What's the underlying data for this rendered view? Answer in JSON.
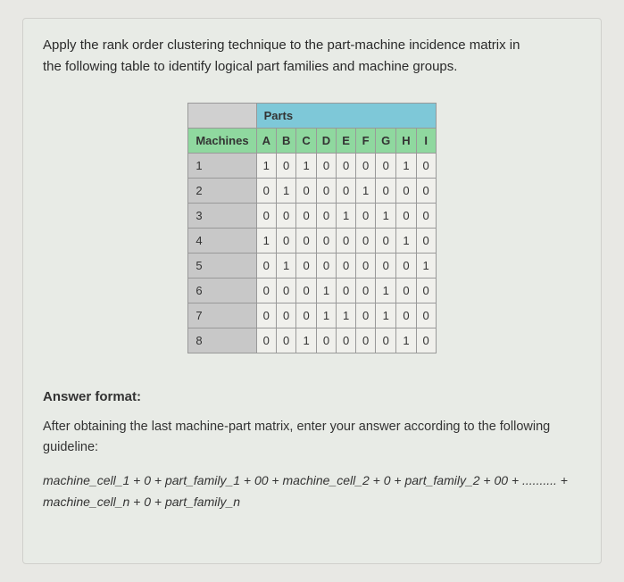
{
  "question": {
    "line1": "Apply the rank order clustering technique to the part-machine incidence matrix in",
    "line2": "the following table to identify logical part families and machine groups."
  },
  "table": {
    "parts_header": "Parts",
    "machines_label": "Machines",
    "parts": [
      "A",
      "B",
      "C",
      "D",
      "E",
      "F",
      "G",
      "H",
      "I"
    ],
    "machines": [
      "1",
      "2",
      "3",
      "4",
      "5",
      "6",
      "7",
      "8"
    ],
    "matrix": [
      [
        1,
        0,
        1,
        0,
        0,
        0,
        0,
        1,
        0
      ],
      [
        0,
        1,
        0,
        0,
        0,
        1,
        0,
        0,
        0
      ],
      [
        0,
        0,
        0,
        0,
        1,
        0,
        1,
        0,
        0
      ],
      [
        1,
        0,
        0,
        0,
        0,
        0,
        0,
        1,
        0
      ],
      [
        0,
        1,
        0,
        0,
        0,
        0,
        0,
        0,
        1
      ],
      [
        0,
        0,
        0,
        1,
        0,
        0,
        1,
        0,
        0
      ],
      [
        0,
        0,
        0,
        1,
        1,
        0,
        1,
        0,
        0
      ],
      [
        0,
        0,
        1,
        0,
        0,
        0,
        0,
        1,
        0
      ]
    ]
  },
  "answer": {
    "heading": "Answer format:",
    "instruction": "After obtaining the last machine-part matrix, enter your answer according to the following guideline:",
    "format_line": "machine_cell_1 + 0 + part_family_1 + 00 + machine_cell_2 + 0 + part_family_2 + 00 + .......... + machine_cell_n + 0 + part_family_n"
  }
}
